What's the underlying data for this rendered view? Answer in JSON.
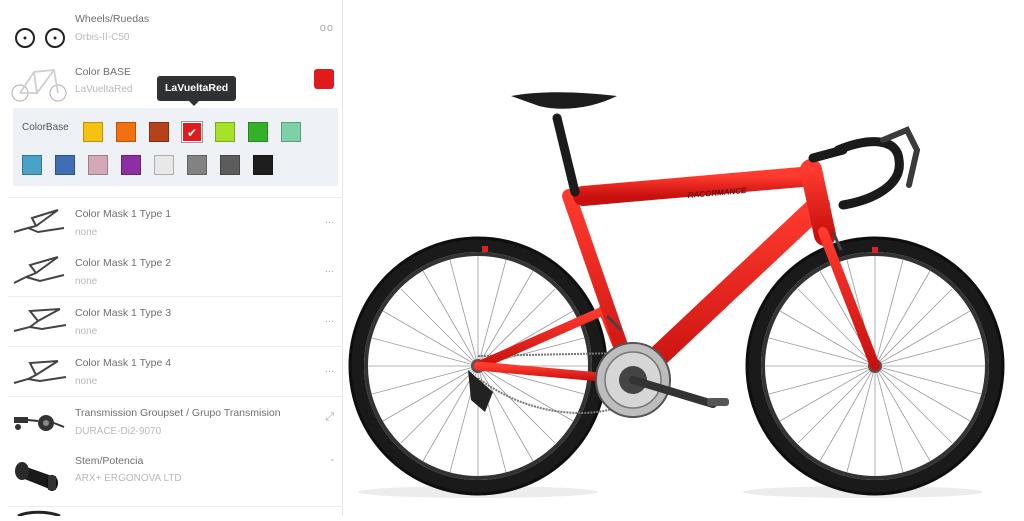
{
  "sidebar": {
    "rows": [
      {
        "title": "Wheels/Ruedas",
        "value": "Orbis-II-C50",
        "action": "oo",
        "thumb_icon": "wheels-icon"
      },
      {
        "title": "Color BASE",
        "value": "LaVueltaRed",
        "action_color": "#e11b1b",
        "thumb_icon": "frame-icon"
      },
      {
        "title": "Color Mask 1 Type 1",
        "value": "none",
        "action": "...",
        "thumb_icon": "frame-mask-icon"
      },
      {
        "title": "Color Mask 1 Type 2",
        "value": "none",
        "action": "...",
        "thumb_icon": "frame-mask-icon"
      },
      {
        "title": "Color Mask 1 Type 3",
        "value": "none",
        "action": "...",
        "thumb_icon": "frame-mask-icon"
      },
      {
        "title": "Color Mask 1 Type 4",
        "value": "none",
        "action": "...",
        "thumb_icon": "frame-mask-icon"
      },
      {
        "title": "Transmission Groupset / Grupo Transmision",
        "value": "DURACE-Di2-9070",
        "action": "⤢",
        "thumb_icon": "groupset-icon"
      },
      {
        "title": "Stem/Potencia",
        "value": "ARX+ ERGONOVA LTD",
        "action": "-",
        "thumb_icon": "stem-icon"
      }
    ]
  },
  "color_panel": {
    "label": "ColorBase",
    "tooltip": "LaVueltaRed",
    "selected": "#e11b1b",
    "swatches": [
      "#f5c211",
      "#f46f0f",
      "#b5421a",
      "#e11b1b",
      "#a6e22a",
      "#35b02b",
      "#7ed0a6",
      "#4aa2c7",
      "#3f6eb5",
      "#d4a8b6",
      "#8d2fa3",
      "#e8e8e8",
      "#828282",
      "#5c5c5c",
      "#1e1e1e"
    ]
  },
  "colors": {
    "frame_red": "#e11b1b",
    "accent": "#e11b1b"
  }
}
